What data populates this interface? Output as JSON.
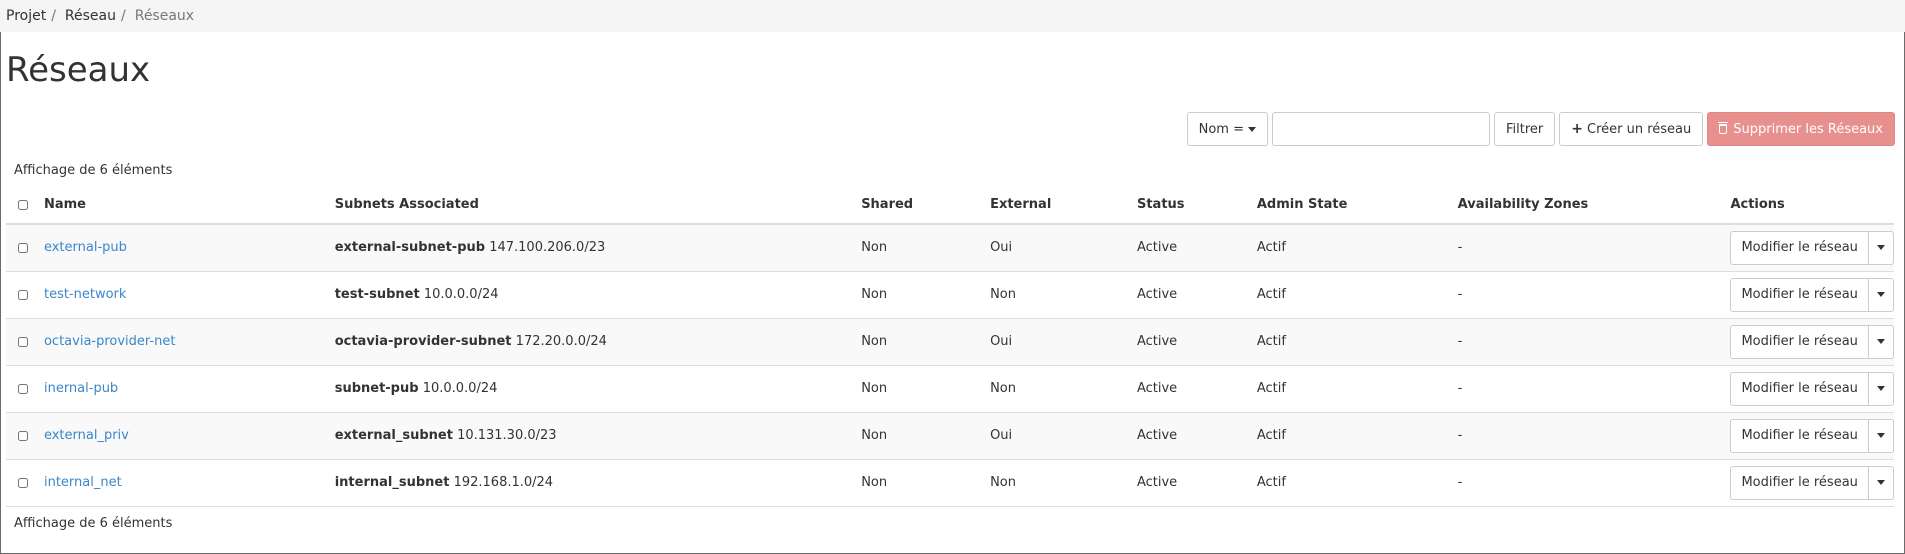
{
  "breadcrumb": {
    "items": [
      "Projet",
      "Réseau"
    ],
    "current": "Réseaux"
  },
  "page": {
    "title": "Réseaux"
  },
  "toolbar": {
    "filter_field_label": "Nom =",
    "search_value": "",
    "filter_button": "Filtrer",
    "create_button": "Créer un réseau",
    "delete_button": "Supprimer les Réseaux"
  },
  "summary": {
    "top": "Affichage de 6 éléments",
    "bottom": "Affichage de 6 éléments"
  },
  "table": {
    "columns": [
      "Name",
      "Subnets Associated",
      "Shared",
      "External",
      "Status",
      "Admin State",
      "Availability Zones",
      "Actions"
    ],
    "rows": [
      {
        "name": "external-pub",
        "subnet_name": "external-subnet-pub",
        "subnet_cidr": "147.100.206.0/23",
        "shared": "Non",
        "external": "Oui",
        "status": "Active",
        "admin_state": "Actif",
        "az": "-",
        "action": "Modifier le réseau"
      },
      {
        "name": "test-network",
        "subnet_name": "test-subnet",
        "subnet_cidr": "10.0.0.0/24",
        "shared": "Non",
        "external": "Non",
        "status": "Active",
        "admin_state": "Actif",
        "az": "-",
        "action": "Modifier le réseau"
      },
      {
        "name": "octavia-provider-net",
        "subnet_name": "octavia-provider-subnet",
        "subnet_cidr": "172.20.0.0/24",
        "shared": "Non",
        "external": "Oui",
        "status": "Active",
        "admin_state": "Actif",
        "az": "-",
        "action": "Modifier le réseau"
      },
      {
        "name": "inernal-pub",
        "subnet_name": "subnet-pub",
        "subnet_cidr": "10.0.0.0/24",
        "shared": "Non",
        "external": "Non",
        "status": "Active",
        "admin_state": "Actif",
        "az": "-",
        "action": "Modifier le réseau"
      },
      {
        "name": "external_priv",
        "subnet_name": "external_subnet",
        "subnet_cidr": "10.131.30.0/23",
        "shared": "Non",
        "external": "Oui",
        "status": "Active",
        "admin_state": "Actif",
        "az": "-",
        "action": "Modifier le réseau"
      },
      {
        "name": "internal_net",
        "subnet_name": "internal_subnet",
        "subnet_cidr": "192.168.1.0/24",
        "shared": "Non",
        "external": "Non",
        "status": "Active",
        "admin_state": "Actif",
        "az": "-",
        "action": "Modifier le réseau"
      }
    ]
  },
  "colors": {
    "link": "#3a87c9",
    "danger": "#e7908e",
    "breadcrumb_bg": "#f5f5f5"
  }
}
